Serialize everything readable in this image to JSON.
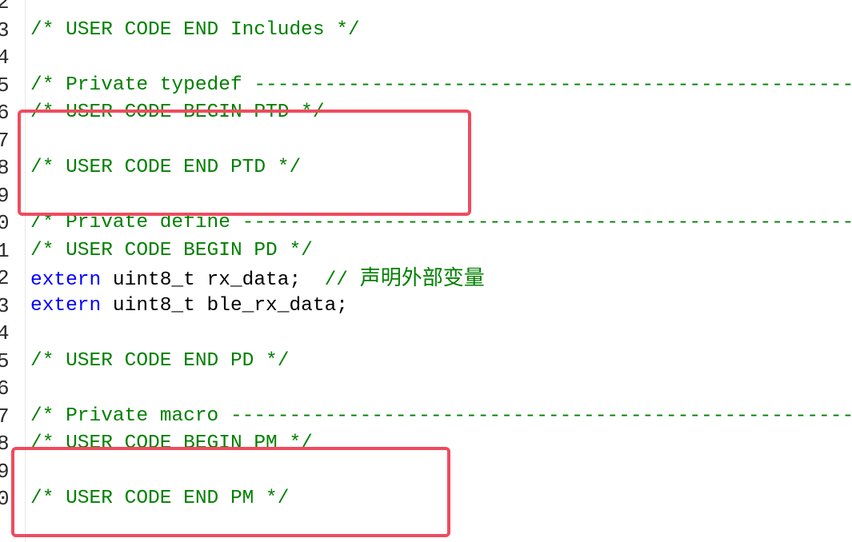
{
  "editor": {
    "line_numbers": [
      "2",
      "3",
      "4",
      "5",
      "6",
      "7",
      "8",
      "9",
      "0",
      "1",
      "2",
      "3",
      "4",
      "5",
      "6",
      "7",
      "8",
      "9",
      "0"
    ],
    "lines": [
      {
        "segments": []
      },
      {
        "segments": [
          {
            "type": "comment",
            "text": "/* USER CODE END Includes */"
          }
        ]
      },
      {
        "segments": []
      },
      {
        "segments": [
          {
            "type": "comment",
            "text": "/* Private typedef -----------------------------------------------------------"
          }
        ]
      },
      {
        "segments": [
          {
            "type": "comment",
            "text": "/* USER CODE BEGIN PTD */"
          }
        ]
      },
      {
        "segments": []
      },
      {
        "segments": [
          {
            "type": "comment",
            "text": "/* USER CODE END PTD */"
          }
        ]
      },
      {
        "segments": []
      },
      {
        "segments": [
          {
            "type": "comment",
            "text": "/* Private define ------------------------------------------------------------"
          }
        ]
      },
      {
        "segments": [
          {
            "type": "comment",
            "text": "/* USER CODE BEGIN PD */"
          }
        ]
      },
      {
        "segments": [
          {
            "type": "keyword",
            "text": "extern"
          },
          {
            "type": "plain",
            "text": " uint8_t rx_data;  "
          },
          {
            "type": "comment",
            "text": "// "
          },
          {
            "type": "cjk",
            "text": "声明外部变量"
          }
        ]
      },
      {
        "segments": [
          {
            "type": "keyword",
            "text": "extern"
          },
          {
            "type": "plain",
            "text": " uint8_t ble_rx_data;"
          }
        ]
      },
      {
        "segments": []
      },
      {
        "segments": [
          {
            "type": "comment",
            "text": "/* USER CODE END PD */"
          }
        ]
      },
      {
        "segments": []
      },
      {
        "segments": [
          {
            "type": "comment",
            "text": "/* Private macro -------------------------------------------------------------"
          }
        ]
      },
      {
        "segments": [
          {
            "type": "comment",
            "text": "/* USER CODE BEGIN PM */"
          }
        ]
      },
      {
        "segments": []
      },
      {
        "segments": [
          {
            "type": "comment",
            "text": "/* USER CODE END PM */"
          }
        ]
      }
    ]
  },
  "colors": {
    "comment": "#008000",
    "keyword": "#0000ff",
    "plain": "#000000",
    "highlight": "#ef4b5f"
  }
}
